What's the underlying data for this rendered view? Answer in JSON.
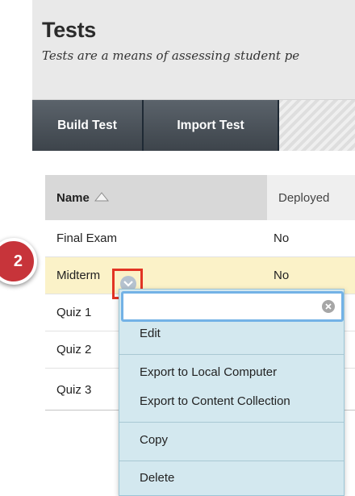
{
  "header": {
    "title": "Tests",
    "subtitle": "Tests are a means of assessing student pe"
  },
  "toolbar": {
    "build_label": "Build Test",
    "import_label": "Import Test"
  },
  "table": {
    "columns": {
      "name": "Name",
      "deployed": "Deployed"
    },
    "sort_icon": "sort-up-triangle-icon",
    "rows": [
      {
        "name": "Final Exam",
        "deployed": "No"
      },
      {
        "name": "Midterm",
        "deployed": "No"
      },
      {
        "name": "Quiz 1",
        "deployed": ""
      },
      {
        "name": "Quiz 2",
        "deployed": ""
      },
      {
        "name": "Quiz 3",
        "deployed": ""
      }
    ]
  },
  "step_badge": "2",
  "context_menu": {
    "search_value": "",
    "search_placeholder": "",
    "items": [
      "Edit",
      "Export to Local Computer",
      "Export to Content Collection",
      "Copy",
      "Delete"
    ]
  },
  "colors": {
    "toolbar_button": "#4b535b",
    "highlight_row": "#fbf2c8",
    "menu_bg": "#d3e8ef",
    "badge": "#c7343a",
    "callout_box": "#e23424"
  }
}
